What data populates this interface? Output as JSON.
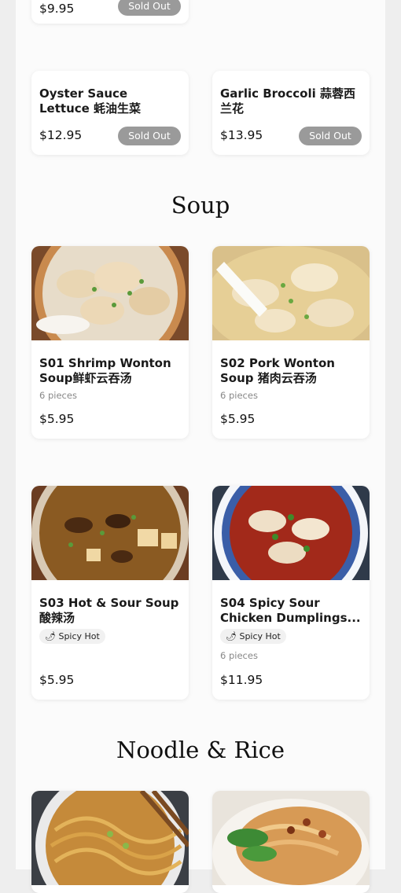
{
  "top_card": {
    "price": "$9.95",
    "status": "Sold Out"
  },
  "greens": [
    {
      "name": "Oyster Sauce Lettuce 蚝油生菜",
      "price": "$12.95",
      "status": "Sold Out"
    },
    {
      "name": "Garlic Broccoli 蒜蓉西兰花",
      "price": "$13.95",
      "status": "Sold Out"
    }
  ],
  "sections": {
    "soup": "Soup",
    "noodle_rice": "Noodle & Rice"
  },
  "soup_items": [
    {
      "name": "S01 Shrimp Wonton Soup鲜虾云吞汤",
      "desc": "6 pieces",
      "price": "$5.95",
      "image": "wonton-bowl"
    },
    {
      "name": "S02 Pork Wonton Soup 猪肉云吞汤",
      "desc": "6 pieces",
      "price": "$5.95",
      "image": "wonton-broth"
    },
    {
      "name": "S03 Hot & Sour Soup酸辣汤",
      "badge": "🌶 Spicy Hot",
      "price": "$5.95",
      "image": "hot-sour-soup"
    },
    {
      "name": "S04 Spicy Sour Chicken Dumplings...",
      "badge": "🌶 Spicy Hot",
      "desc": "6 pieces",
      "price": "$11.95",
      "image": "spicy-dumplings"
    }
  ],
  "noodle_items": [
    {
      "image": "noodles-chopsticks"
    },
    {
      "image": "noodles-greens"
    }
  ]
}
